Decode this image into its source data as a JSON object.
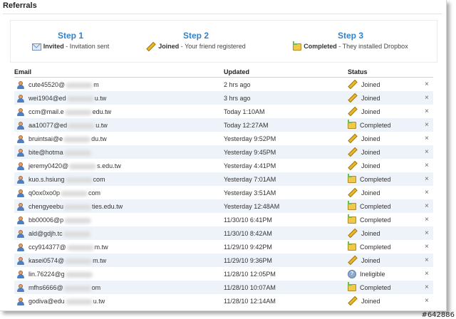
{
  "page": {
    "title": "Referrals"
  },
  "steps": [
    {
      "name": "Step 1",
      "status": "Invited",
      "desc": "Invitation sent",
      "icon": "envelope-icon"
    },
    {
      "name": "Step 2",
      "status": "Joined",
      "desc": "Your friend registered",
      "icon": "pencil-icon"
    },
    {
      "name": "Step 3",
      "status": "Completed",
      "desc": "They installed Dropbox",
      "icon": "box-icon"
    }
  ],
  "table": {
    "headers": {
      "email": "Email",
      "updated": "Updated",
      "status": "Status"
    },
    "rows": [
      {
        "email_pre": "cute45520@",
        "email_post": "m",
        "updated": "2 hrs ago",
        "status": "Joined"
      },
      {
        "email_pre": "wei1904@ed",
        "email_post": "u.tw",
        "updated": "3 hrs ago",
        "status": "Joined"
      },
      {
        "email_pre": "ccm@mail.e",
        "email_post": "edu.tw",
        "updated": "Today 1:10AM",
        "status": "Joined"
      },
      {
        "email_pre": "aa10077@ed",
        "email_post": "u.tw",
        "updated": "Today 12:27AM",
        "status": "Completed"
      },
      {
        "email_pre": "bruintsai@e",
        "email_post": "du.tw",
        "updated": "Yesterday 9:52PM",
        "status": "Joined"
      },
      {
        "email_pre": "bite@hotma",
        "email_post": "",
        "updated": "Yesterday 9:45PM",
        "status": "Joined"
      },
      {
        "email_pre": "jeremy0420@",
        "email_post": "s.edu.tw",
        "updated": "Yesterday 4:41PM",
        "status": "Joined"
      },
      {
        "email_pre": "kuo.s.hsiung",
        "email_post": "com",
        "updated": "Yesterday 7:01AM",
        "status": "Completed"
      },
      {
        "email_pre": "q0ox0xo0p",
        "email_post": "com",
        "updated": "Yesterday 3:51AM",
        "status": "Joined"
      },
      {
        "email_pre": "chengyeebu",
        "email_post": "ties.edu.tw",
        "updated": "Yesterday 12:48AM",
        "status": "Completed"
      },
      {
        "email_pre": "bb00006@p",
        "email_post": "",
        "updated": "11/30/10 6:41PM",
        "status": "Completed"
      },
      {
        "email_pre": "ald@gdjh.tc",
        "email_post": "",
        "updated": "11/30/10 8:42AM",
        "status": "Joined"
      },
      {
        "email_pre": "ccy914377@",
        "email_post": "m.tw",
        "updated": "11/29/10 9:42PM",
        "status": "Completed"
      },
      {
        "email_pre": "kasei0574@",
        "email_post": "m.tw",
        "updated": "11/29/10 9:36PM",
        "status": "Joined"
      },
      {
        "email_pre": "lin.76224@g",
        "email_post": "",
        "updated": "11/28/10 12:05PM",
        "status": "Ineligible"
      },
      {
        "email_pre": "mfhs6666@",
        "email_post": "om",
        "updated": "11/28/10 10:07AM",
        "status": "Completed"
      },
      {
        "email_pre": "godiva@edu",
        "email_post": "u.tw",
        "updated": "11/28/10 12:14AM",
        "status": "Joined"
      }
    ]
  },
  "badge": "#642886",
  "colors": {
    "step_title": "#3581c8",
    "alt_row": "#eef3fa"
  }
}
